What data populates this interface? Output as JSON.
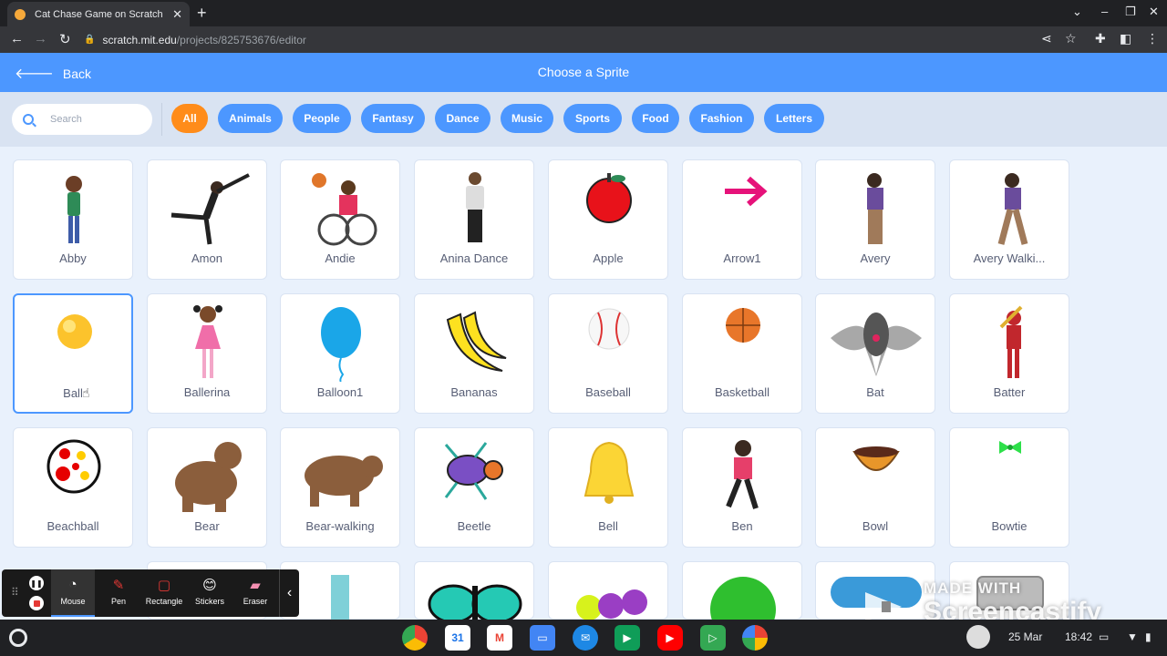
{
  "browser": {
    "tab_title": "Cat Chase Game on Scratch",
    "url_host": "scratch.mit.edu",
    "url_path": "/projects/825753676/editor"
  },
  "header": {
    "back_label": "Back",
    "title": "Choose a Sprite"
  },
  "search": {
    "placeholder": "Search"
  },
  "categories": [
    "All",
    "Animals",
    "People",
    "Fantasy",
    "Dance",
    "Music",
    "Sports",
    "Food",
    "Fashion",
    "Letters"
  ],
  "active_category": "All",
  "sprites": [
    "Abby",
    "Amon",
    "Andie",
    "Anina Dance",
    "Apple",
    "Arrow1",
    "Avery",
    "Avery Walki...",
    "Ball",
    "Ballerina",
    "Balloon1",
    "Bananas",
    "Baseball",
    "Basketball",
    "Bat",
    "Batter",
    "Beachball",
    "Bear",
    "Bear-walking",
    "Beetle",
    "Bell",
    "Ben",
    "Bowl",
    "Bowtie"
  ],
  "selected_sprite": "Ball",
  "annotation_toolbar": {
    "tools": [
      "Mouse",
      "Pen",
      "Rectangle",
      "Stickers",
      "Eraser"
    ],
    "selected_tool": "Mouse"
  },
  "watermark": {
    "line1": "MADE WITH",
    "line2": "Screencastify"
  },
  "shelf": {
    "date": "25 Mar",
    "time": "18:42"
  },
  "colors": {
    "accent": "#4c97ff",
    "active_pill": "#ff8c1a",
    "label": "#575e75"
  }
}
